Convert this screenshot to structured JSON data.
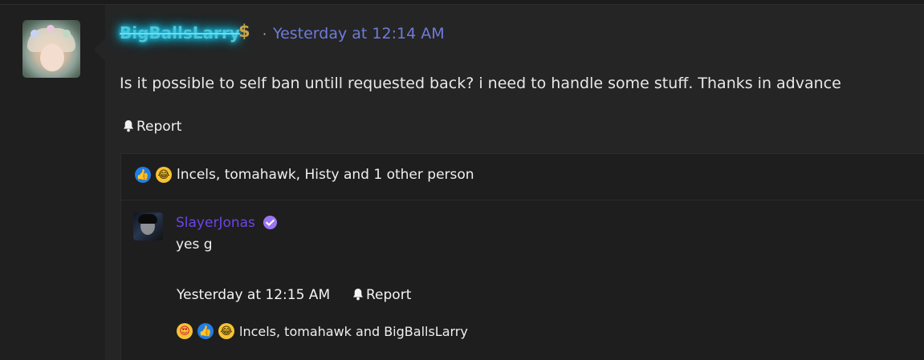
{
  "post": {
    "username": "BigBallsLarry",
    "separator": "·",
    "timestamp": "Yesterday at 12:14 AM",
    "message": "Is it possible to self ban untill requested back? i need to handle some stuff. Thanks in advance",
    "report_label": "Report",
    "badge_icon": "dollar-icon",
    "reactions": {
      "icons": [
        "like-icon",
        "crying-laughing-icon"
      ],
      "text": "lncels, tomahawk, Histy and 1 other person"
    }
  },
  "reply": {
    "username": "SlayerJonas",
    "verified_icon": "verified-badge-icon",
    "text": "yes g",
    "timestamp": "Yesterday at 12:15 AM",
    "report_label": "Report",
    "reactions": {
      "icons": [
        "heart-eyes-icon",
        "like-icon",
        "crying-laughing-icon"
      ],
      "text": "lncels, tomahawk and BigBallsLarry"
    }
  },
  "colors": {
    "background": "#1b1b1b",
    "card": "#252525",
    "username_glow": "#16c0e6",
    "timestamp_link": "#6f7bd9",
    "reply_username": "#6c45e7"
  }
}
